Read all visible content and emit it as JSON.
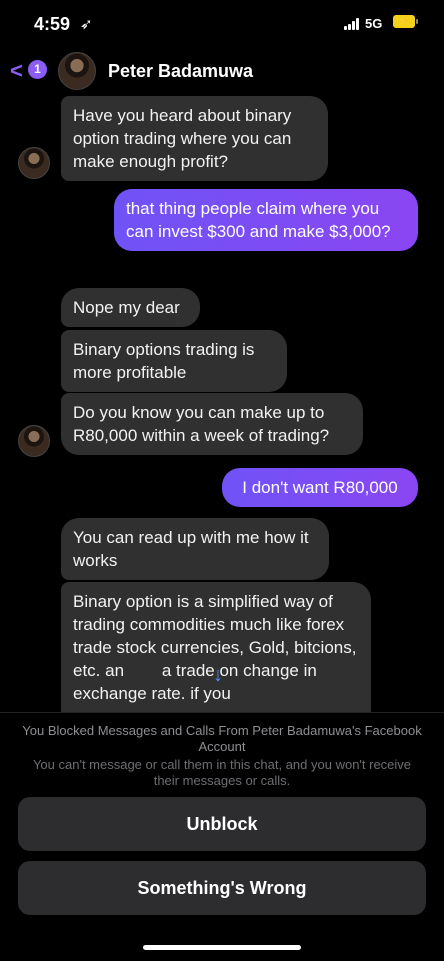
{
  "status_bar": {
    "time": "4:59",
    "network": "5G",
    "battery_level": "⚡"
  },
  "header": {
    "back_badge": "1",
    "contact_name": "Peter Badamuwa"
  },
  "messages": [
    {
      "side": "in",
      "text": "Have you heard about binary option trading where you can make enough profit?"
    },
    {
      "side": "out",
      "text": "that thing people claim where you can invest $300 and make $3,000?"
    },
    {
      "side": "in",
      "text": "Nope my dear"
    },
    {
      "side": "in",
      "text": "Binary options trading is more profitable"
    },
    {
      "side": "in",
      "text": "Do you know you can make up to R80,000 within a week of trading?"
    },
    {
      "side": "out",
      "text": "I don't want R80,000"
    },
    {
      "side": "in",
      "text": "You can read up with me how it works"
    },
    {
      "side": "in",
      "text": "Binary option is a simplified way of trading commodities much like forex trade stock currencies, Gold, bitcions, etc. an        a trade on change in exchange rate. if you"
    }
  ],
  "blocked_notice": {
    "title": "You Blocked Messages and Calls From Peter Badamuwa's Facebook Account",
    "subtitle": "You can't message or call them in this chat, and you won't receive their messages or calls."
  },
  "buttons": {
    "unblock": "Unblock",
    "something_wrong": "Something's Wrong"
  },
  "colors": {
    "accent": "#8b5cf6",
    "outgoing_bubble": "#7c4dff",
    "incoming_bubble": "#303030"
  }
}
